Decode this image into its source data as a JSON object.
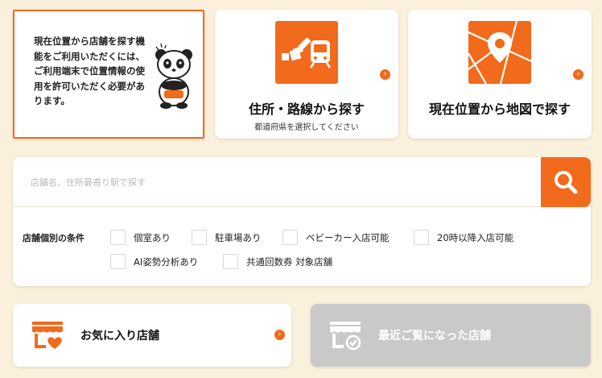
{
  "notice": {
    "text": "現在位置から店舗を探す機能をご利用いただくには、ご利用端末で位置情報の使用を許可いただく必要があります。"
  },
  "address_card": {
    "title": "住所・路線から探す",
    "subtitle": "都道府県を選択してください",
    "icon": "train-icon"
  },
  "map_card": {
    "title": "現在位置から地図で探す",
    "icon": "map-pin-icon"
  },
  "search": {
    "placeholder": "店舗名、住所最寄り駅で探す",
    "value": ""
  },
  "conditions": {
    "label": "店舗個別の条件",
    "options": [
      {
        "label": "個室あり",
        "checked": false
      },
      {
        "label": "駐車場あり",
        "checked": false
      },
      {
        "label": "ベビーカー入店可能",
        "checked": false
      },
      {
        "label": "20時以降入店可能",
        "checked": false
      },
      {
        "label": "AI姿勢分析あり",
        "checked": false
      },
      {
        "label": "共通回数券 対象店舗",
        "checked": false
      }
    ]
  },
  "favorites": {
    "label": "お気に入り店舗",
    "icon": "store-heart-icon"
  },
  "recent": {
    "label": "最近ご覧になった店舗",
    "icon": "store-check-icon"
  },
  "colors": {
    "accent": "#f26a1b",
    "background": "#faf0dc",
    "disabled": "#c9c9c9"
  }
}
